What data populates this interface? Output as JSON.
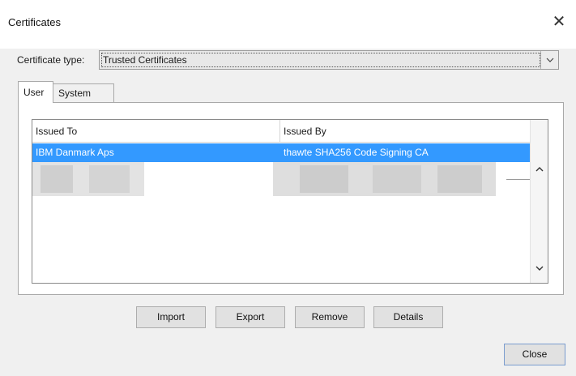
{
  "window": {
    "title": "Certificates",
    "close_glyph": "✕"
  },
  "certificate_type": {
    "label": "Certificate type:",
    "selected": "Trusted Certificates"
  },
  "tabs": [
    {
      "label": "User",
      "active": true
    },
    {
      "label": "System",
      "active": false
    }
  ],
  "table": {
    "columns": [
      "Issued To",
      "Issued By"
    ],
    "rows": [
      {
        "issued_to": "IBM Danmark Aps",
        "issued_by": "thawte SHA256 Code Signing CA",
        "selected": true
      }
    ]
  },
  "buttons": {
    "import": "Import",
    "export": "Export",
    "remove": "Remove",
    "details": "Details",
    "close": "Close"
  },
  "icons": {
    "close": "close-icon",
    "dropdown": "chevron-down-icon",
    "scroll_up": "chevron-up-icon",
    "scroll_down": "chevron-down-icon"
  },
  "colors": {
    "selection": "#3399ff",
    "dialog_bg": "#f0f0f0",
    "titlebar_bg": "#ffffff"
  }
}
